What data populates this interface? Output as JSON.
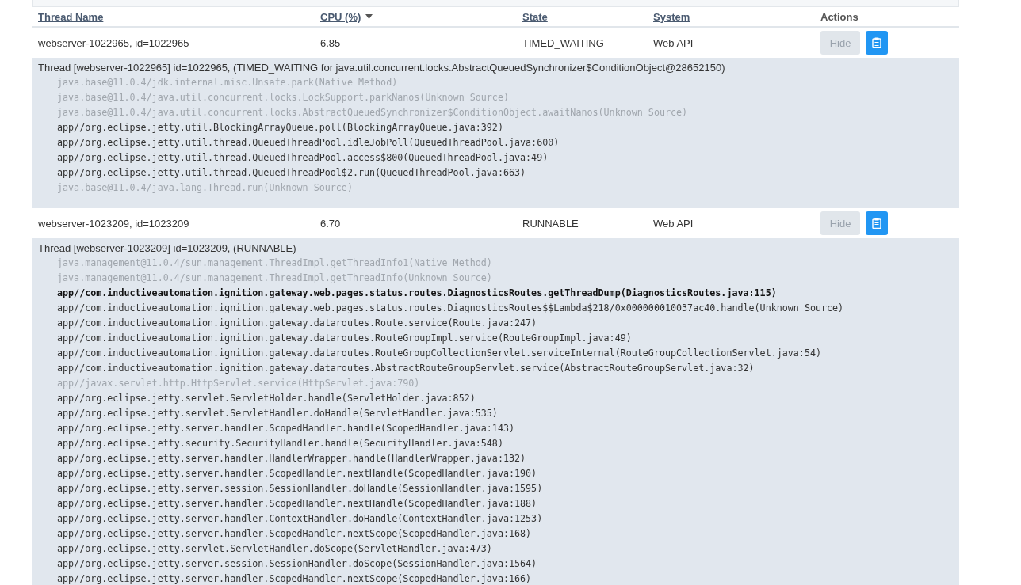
{
  "table": {
    "columns": [
      {
        "label": "Thread Name",
        "sortable": true,
        "sorted": false
      },
      {
        "label": "CPU (%)",
        "sortable": true,
        "sorted": true
      },
      {
        "label": "State",
        "sortable": true,
        "sorted": false
      },
      {
        "label": "System",
        "sortable": true,
        "sorted": false
      },
      {
        "label": "Actions",
        "sortable": false,
        "sorted": false
      }
    ],
    "rows": [
      {
        "name": "webserver-1022965, id=1022965",
        "cpu": "6.85",
        "state": "TIMED_WAITING",
        "system": "Web API",
        "hide_label": "Hide",
        "hide_disabled": true,
        "trace": {
          "title": "Thread [webserver-1022965] id=1022965, (TIMED_WAITING for java.util.concurrent.locks.AbstractQueuedSynchronizer$ConditionObject@28652150)",
          "lines": [
            {
              "kind": "system",
              "text": "java.base@11.0.4/jdk.internal.misc.Unsafe.park(Native Method)"
            },
            {
              "kind": "system",
              "text": "java.base@11.0.4/java.util.concurrent.locks.LockSupport.parkNanos(Unknown Source)"
            },
            {
              "kind": "system",
              "text": "java.base@11.0.4/java.util.concurrent.locks.AbstractQueuedSynchronizer$ConditionObject.awaitNanos(Unknown Source)"
            },
            {
              "kind": "app",
              "text": "app//org.eclipse.jetty.util.BlockingArrayQueue.poll(BlockingArrayQueue.java:392)"
            },
            {
              "kind": "app",
              "text": "app//org.eclipse.jetty.util.thread.QueuedThreadPool.idleJobPoll(QueuedThreadPool.java:600)"
            },
            {
              "kind": "app",
              "text": "app//org.eclipse.jetty.util.thread.QueuedThreadPool.access$800(QueuedThreadPool.java:49)"
            },
            {
              "kind": "app",
              "text": "app//org.eclipse.jetty.util.thread.QueuedThreadPool$2.run(QueuedThreadPool.java:663)"
            },
            {
              "kind": "system",
              "text": "java.base@11.0.4/java.lang.Thread.run(Unknown Source)"
            }
          ]
        }
      },
      {
        "name": "webserver-1023209, id=1023209",
        "cpu": "6.70",
        "state": "RUNNABLE",
        "system": "Web API",
        "hide_label": "Hide",
        "hide_disabled": true,
        "trace": {
          "title": "Thread [webserver-1023209] id=1023209, (RUNNABLE)",
          "lines": [
            {
              "kind": "system",
              "text": "java.management@11.0.4/sun.management.ThreadImpl.getThreadInfo1(Native Method)"
            },
            {
              "kind": "system",
              "text": "java.management@11.0.4/sun.management.ThreadImpl.getThreadInfo(Unknown Source)"
            },
            {
              "kind": "highlight",
              "text": "app//com.inductiveautomation.ignition.gateway.web.pages.status.routes.DiagnosticsRoutes.getThreadDump(DiagnosticsRoutes.java:115)"
            },
            {
              "kind": "app",
              "text": "app//com.inductiveautomation.ignition.gateway.web.pages.status.routes.DiagnosticsRoutes$$Lambda$218/0x000000010037ac40.handle(Unknown Source)"
            },
            {
              "kind": "app",
              "text": "app//com.inductiveautomation.ignition.gateway.dataroutes.Route.service(Route.java:247)"
            },
            {
              "kind": "app",
              "text": "app//com.inductiveautomation.ignition.gateway.dataroutes.RouteGroupImpl.service(RouteGroupImpl.java:49)"
            },
            {
              "kind": "app",
              "text": "app//com.inductiveautomation.ignition.gateway.dataroutes.RouteGroupCollectionServlet.serviceInternal(RouteGroupCollectionServlet.java:54)"
            },
            {
              "kind": "app",
              "text": "app//com.inductiveautomation.ignition.gateway.dataroutes.AbstractRouteGroupServlet.service(AbstractRouteGroupServlet.java:32)"
            },
            {
              "kind": "system",
              "text": "app//javax.servlet.http.HttpServlet.service(HttpServlet.java:790)"
            },
            {
              "kind": "app",
              "text": "app//org.eclipse.jetty.servlet.ServletHolder.handle(ServletHolder.java:852)"
            },
            {
              "kind": "app",
              "text": "app//org.eclipse.jetty.servlet.ServletHandler.doHandle(ServletHandler.java:535)"
            },
            {
              "kind": "app",
              "text": "app//org.eclipse.jetty.server.handler.ScopedHandler.handle(ScopedHandler.java:143)"
            },
            {
              "kind": "app",
              "text": "app//org.eclipse.jetty.security.SecurityHandler.handle(SecurityHandler.java:548)"
            },
            {
              "kind": "app",
              "text": "app//org.eclipse.jetty.server.handler.HandlerWrapper.handle(HandlerWrapper.java:132)"
            },
            {
              "kind": "app",
              "text": "app//org.eclipse.jetty.server.handler.ScopedHandler.nextHandle(ScopedHandler.java:190)"
            },
            {
              "kind": "app",
              "text": "app//org.eclipse.jetty.server.session.SessionHandler.doHandle(SessionHandler.java:1595)"
            },
            {
              "kind": "app",
              "text": "app//org.eclipse.jetty.server.handler.ScopedHandler.nextHandle(ScopedHandler.java:188)"
            },
            {
              "kind": "app",
              "text": "app//org.eclipse.jetty.server.handler.ContextHandler.doHandle(ContextHandler.java:1253)"
            },
            {
              "kind": "app",
              "text": "app//org.eclipse.jetty.server.handler.ScopedHandler.nextScope(ScopedHandler.java:168)"
            },
            {
              "kind": "app",
              "text": "app//org.eclipse.jetty.servlet.ServletHandler.doScope(ServletHandler.java:473)"
            },
            {
              "kind": "app",
              "text": "app//org.eclipse.jetty.server.session.SessionHandler.doScope(SessionHandler.java:1564)"
            },
            {
              "kind": "app",
              "text": "app//org.eclipse.jetty.server.handler.ScopedHandler.nextScope(ScopedHandler.java:166)"
            }
          ]
        }
      }
    ]
  }
}
